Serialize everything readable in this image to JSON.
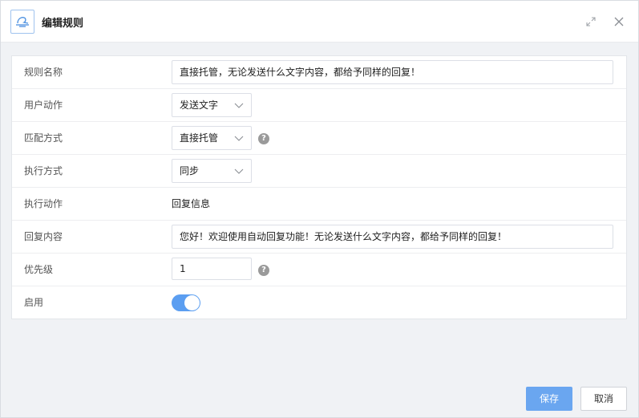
{
  "dialog": {
    "title": "编辑规则",
    "close_icon": "close-icon",
    "expand_icon": "expand-icon",
    "logo_icon": "hat-logo-icon"
  },
  "form": {
    "rule_name": {
      "label": "规则名称",
      "value": "直接托管，无论发送什么文字内容，都给予同样的回复！"
    },
    "user_action": {
      "label": "用户动作",
      "value": "发送文字"
    },
    "match_mode": {
      "label": "匹配方式",
      "value": "直接托管",
      "help": "?"
    },
    "exec_mode": {
      "label": "执行方式",
      "value": "同步"
    },
    "exec_action": {
      "label": "执行动作",
      "value": "回复信息"
    },
    "reply_content": {
      "label": "回复内容",
      "value": "您好！欢迎使用自动回复功能！无论发送什么文字内容，都给予同样的回复！"
    },
    "priority": {
      "label": "优先级",
      "value": "1",
      "help": "?"
    },
    "enabled": {
      "label": "启用",
      "value": true
    }
  },
  "footer": {
    "save_label": "保存",
    "cancel_label": "取消"
  },
  "colors": {
    "accent": "#5b9ef1",
    "primary_button": "#6aa6f0",
    "background": "#f0f2f5"
  }
}
